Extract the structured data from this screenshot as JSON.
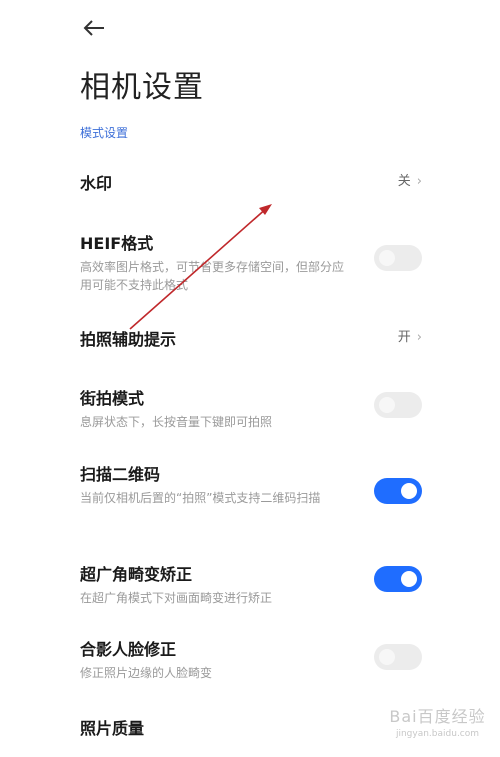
{
  "header": {
    "back_icon": "back-arrow-icon",
    "title": "相机设置"
  },
  "section": {
    "label": "模式设置"
  },
  "settings": [
    {
      "label": "水印",
      "value": "关",
      "type": "link"
    },
    {
      "label": "HEIF格式",
      "desc": "高效率图片格式，可节省更多存储空间，但部分应用可能不支持此格式",
      "type": "toggle",
      "on": false
    },
    {
      "label": "拍照辅助提示",
      "value": "开",
      "type": "link"
    },
    {
      "label": "街拍模式",
      "desc": "息屏状态下，长按音量下键即可拍照",
      "type": "toggle",
      "on": false
    },
    {
      "label": "扫描二维码",
      "desc": "当前仅相机后置的“拍照”模式支持二维码扫描",
      "type": "toggle",
      "on": true
    },
    {
      "label": "超广角畸变矫正",
      "desc": "在超广角模式下对画面畸变进行矫正",
      "type": "toggle",
      "on": true
    },
    {
      "label": "合影人脸修正",
      "desc": "修正照片边缘的人脸畸变",
      "type": "toggle",
      "on": false
    },
    {
      "label": "照片质量",
      "type": "link"
    }
  ],
  "watermark": {
    "text": "Bai百度经验",
    "url": "jingyan.baidu.com"
  },
  "colors": {
    "accent": "#1f6dff",
    "section": "#3d6fd8",
    "annotation_arrow": "#c0282b"
  }
}
